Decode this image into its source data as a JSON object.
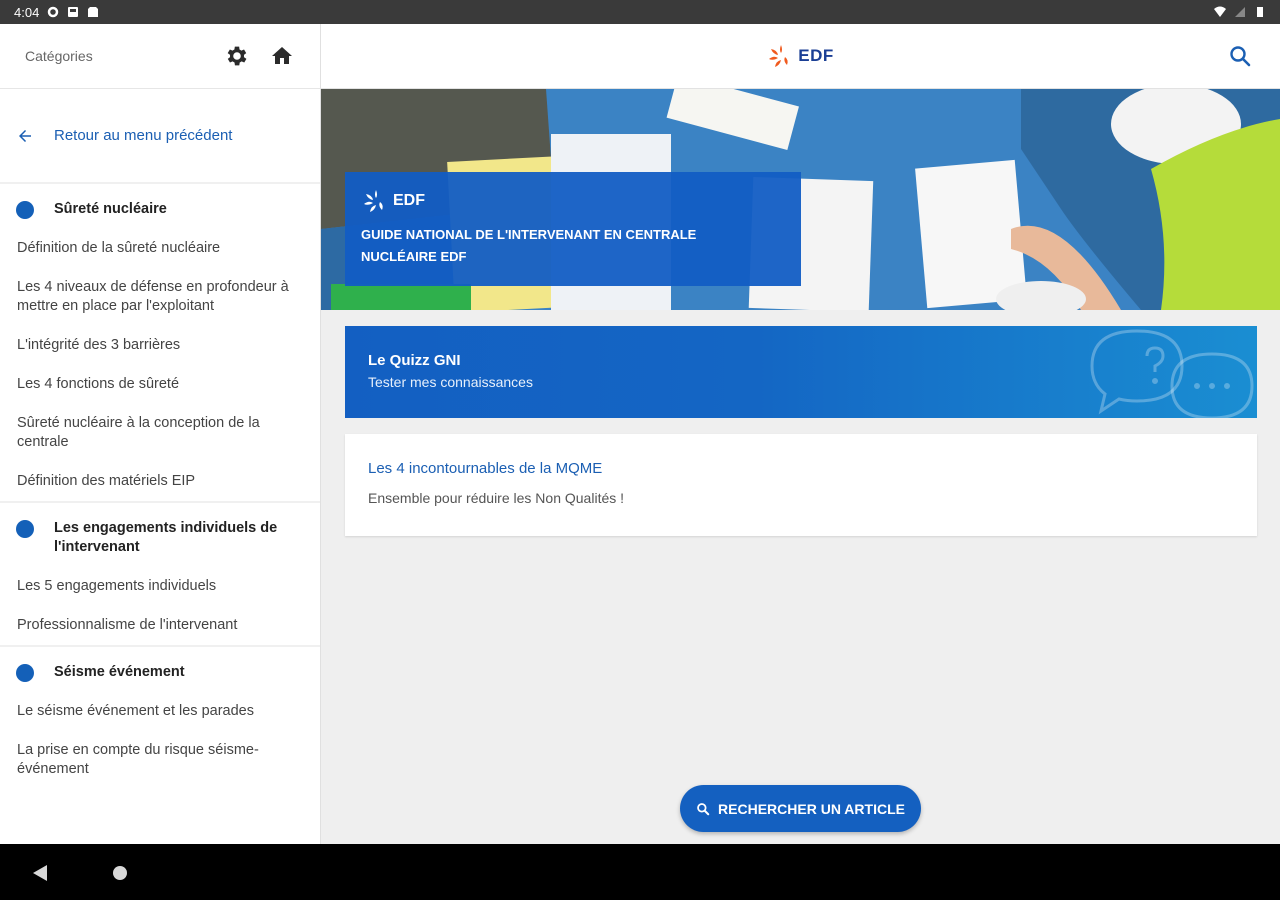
{
  "status_bar": {
    "time": "4:04"
  },
  "sidebar": {
    "header_label": "Catégories",
    "back_label": "Retour au menu précédent",
    "sections": [
      {
        "title": "Sûreté nucléaire",
        "items": [
          "Définition de la sûreté nucléaire",
          "Les 4 niveaux de défense en profondeur à mettre en place par l'exploitant",
          "L'intégrité des 3 barrières",
          "Les 4 fonctions de sûreté",
          "Sûreté nucléaire à la conception de la centrale",
          "Définition des matériels EIP"
        ]
      },
      {
        "title": "Les engagements individuels de l'intervenant",
        "items": [
          "Les 5 engagements individuels",
          "Professionnalisme de l'intervenant"
        ]
      },
      {
        "title": "Séisme événement",
        "items": [
          "Le séisme événement et les parades",
          "La prise en compte du risque séisme-événement"
        ]
      }
    ]
  },
  "topbar": {
    "logo_text": "EDF"
  },
  "hero": {
    "brand": "EDF",
    "title": "GUIDE NATIONAL DE L'INTERVENANT EN CENTRALE NUCLÉAIRE EDF"
  },
  "quiz": {
    "title": "Le Quizz GNI",
    "subtitle": "Tester mes connaissances"
  },
  "article": {
    "title": "Les 4 incontournables de la MQME",
    "description": "Ensemble pour réduire les Non Qualités !"
  },
  "search_article_button": "RECHERCHER UN ARTICLE",
  "colors": {
    "primary": "#1460c0",
    "link": "#1b5fb3",
    "brand_orange": "#f05a1e"
  }
}
